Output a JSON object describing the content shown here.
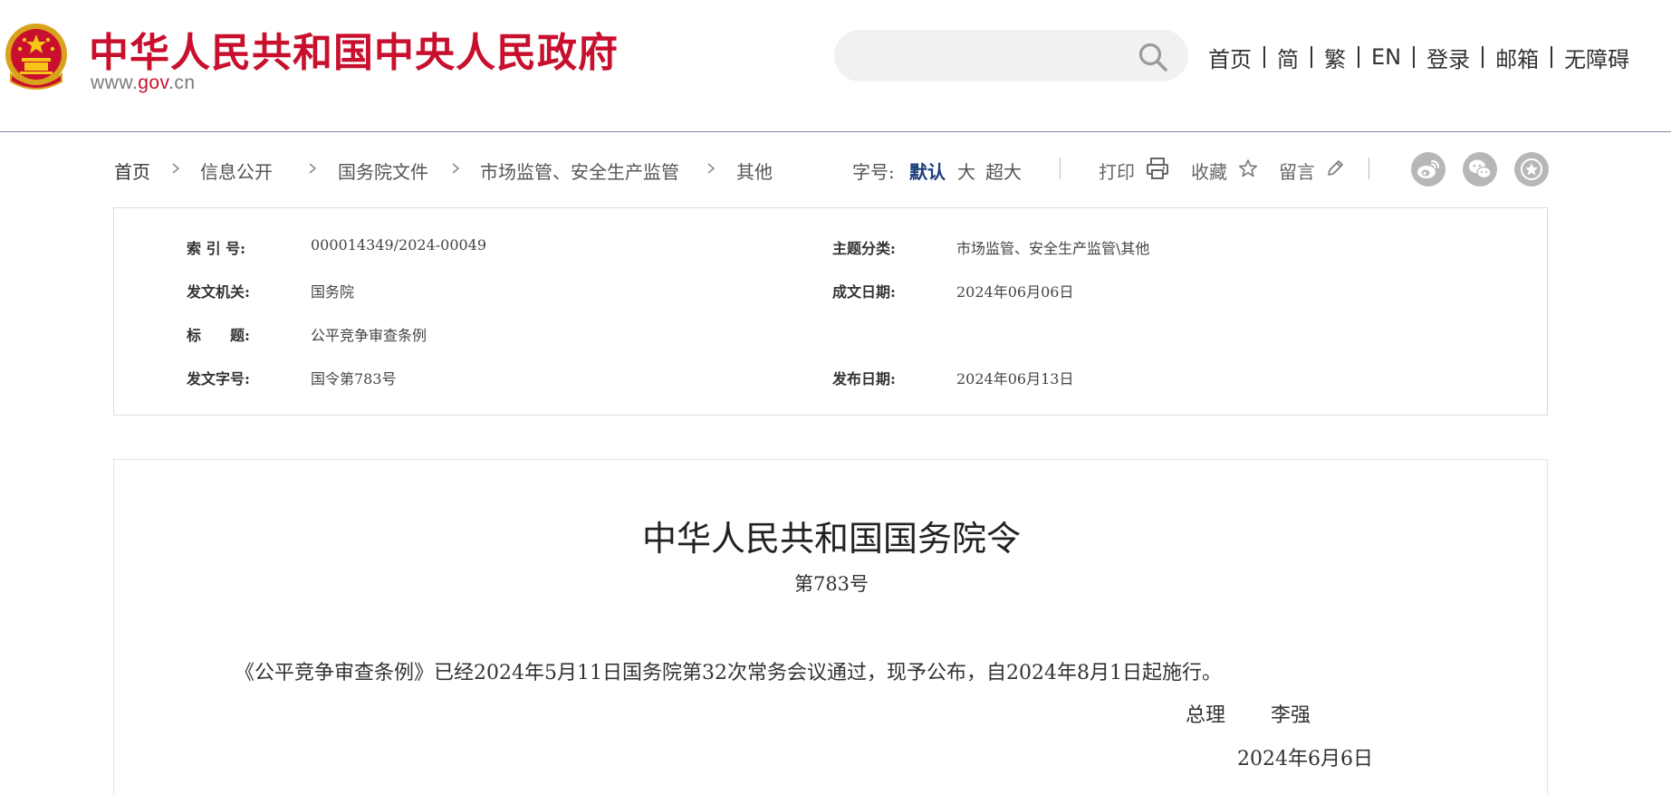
{
  "header": {
    "site_title": "中华人民共和国中央人民政府",
    "site_url_prefix": "www.",
    "site_url_domain": "gov",
    "site_url_suffix": ".cn",
    "search_placeholder": "",
    "nav": [
      "首页",
      "简",
      "繁",
      "EN",
      "登录",
      "邮箱",
      "无障碍"
    ]
  },
  "breadcrumb": [
    "首页",
    "信息公开",
    "国务院文件",
    "市场监管、安全生产监管",
    "其他"
  ],
  "toolbar": {
    "font_size_label": "字号:",
    "font_sizes": [
      "默认",
      "大",
      "超大"
    ],
    "active_font_size": "默认",
    "print": "打印",
    "favorite": "收藏",
    "comment": "留言",
    "share_icons": [
      "weibo-icon",
      "wechat-icon",
      "star-share-icon"
    ]
  },
  "meta": {
    "index_no_label": "索 引 号:",
    "index_no": "000014349/2024-00049",
    "category_label": "主题分类:",
    "category": "市场监管、安全生产监管\\其他",
    "issuer_label": "发文机关:",
    "issuer": "国务院",
    "written_date_label": "成文日期:",
    "written_date": "2024年06月06日",
    "title_label": "标　　题:",
    "title": "公平竞争审查条例",
    "doc_no_label": "发文字号:",
    "doc_no": "国令第783号",
    "publish_date_label": "发布日期:",
    "publish_date": "2024年06月13日"
  },
  "document": {
    "title": "中华人民共和国国务院令",
    "number": "第783号",
    "body": "《公平竞争审查条例》已经2024年5月11日国务院第32次常务会议通过，现予公布，自2024年8月1日起施行。",
    "sign_role": "总理",
    "sign_name": "李强",
    "sign_date": "2024年6月6日"
  },
  "colors": {
    "brand_red": "#c8102e",
    "active_blue": "#1a3d7c",
    "share_gray": "#b7b7b7"
  }
}
